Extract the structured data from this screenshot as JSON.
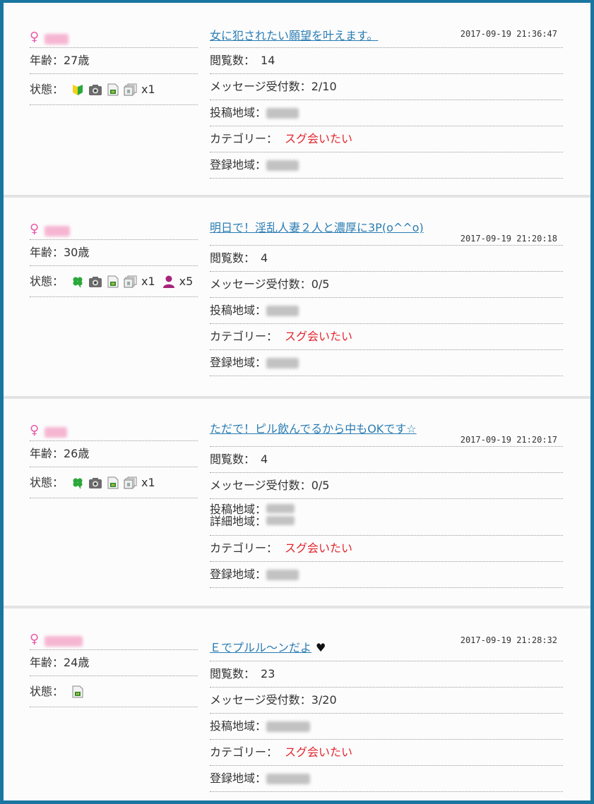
{
  "posts": [
    {
      "age_text": "年齢：27歳",
      "status_label": "状態：",
      "status_icons": [
        "beginner-icon",
        "camera-icon",
        "sim-card-icon",
        "photo-stack-icon"
      ],
      "photo_count": "x1",
      "member_count": "",
      "title": "女に犯されたい願望を叶えます。",
      "title_suffix": "",
      "timestamp": "2017-09-19 21:36:47",
      "views_label": "閲覧数：",
      "views": "14",
      "messages_label": "メッセージ受付数：",
      "messages": "2/10",
      "post_area_label": "投稿地域：",
      "detail_area_label": "",
      "category_label": "カテゴリー：",
      "category": "スグ会いたい",
      "reg_area_label": "登録地域："
    },
    {
      "age_text": "年齢：30歳",
      "status_label": "状態：",
      "status_icons": [
        "clover-icon",
        "camera-icon",
        "sim-card-icon",
        "photo-stack-icon",
        "person-icon"
      ],
      "photo_count": "x1",
      "member_count": "x5",
      "title": "明日で！淫乱人妻２人と濃厚に3P(o^^o)",
      "title_suffix": "",
      "timestamp": "2017-09-19 21:20:18",
      "views_label": "閲覧数：",
      "views": "4",
      "messages_label": "メッセージ受付数：",
      "messages": "0/5",
      "post_area_label": "投稿地域：",
      "detail_area_label": "",
      "category_label": "カテゴリー：",
      "category": "スグ会いたい",
      "reg_area_label": "登録地域："
    },
    {
      "age_text": "年齢：26歳",
      "status_label": "状態：",
      "status_icons": [
        "clover-icon",
        "camera-icon",
        "sim-card-icon",
        "photo-stack-icon"
      ],
      "photo_count": "x1",
      "member_count": "",
      "title": "ただで！ピル飲んでるから中もOKです☆",
      "title_suffix": "",
      "timestamp": "2017-09-19 21:20:17",
      "views_label": "閲覧数：",
      "views": "4",
      "messages_label": "メッセージ受付数：",
      "messages": "0/5",
      "post_area_label": "投稿地域：",
      "detail_area_label": "詳細地域：",
      "category_label": "カテゴリー：",
      "category": "スグ会いたい",
      "reg_area_label": "登録地域："
    },
    {
      "age_text": "年齢：24歳",
      "status_label": "状態：",
      "status_icons": [
        "sim-card-icon"
      ],
      "photo_count": "",
      "member_count": "",
      "title": "Ｅでプルル〜ンだよ",
      "title_suffix": "♥",
      "timestamp": "2017-09-19 21:28:32",
      "views_label": "閲覧数：",
      "views": "23",
      "messages_label": "メッセージ受付数：",
      "messages": "3/20",
      "post_area_label": "投稿地域：",
      "detail_area_label": "",
      "category_label": "カテゴリー：",
      "category": "スグ会いたい",
      "reg_area_label": "登録地域："
    }
  ],
  "colors": {
    "frame": "#1a76a0",
    "link": "#2b7db3",
    "category": "#e3262f",
    "female": "#e85aa8"
  }
}
